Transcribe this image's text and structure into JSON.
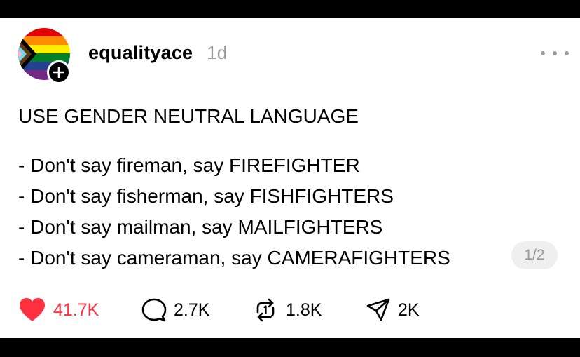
{
  "post": {
    "username": "equalityace",
    "timestamp": "1d",
    "headline": "USE GENDER NEUTRAL LANGUAGE",
    "lines": [
      "- Don't say fireman, say FIREFIGHTER",
      "- Don't say fisherman, say FISHFIGHTERS",
      "- Don't say mailman, say MAILFIGHTERS",
      "- Don't say cameraman, say CAMERAFIGHTERS"
    ],
    "page_indicator": "1/2"
  },
  "actions": {
    "likes": "41.7K",
    "replies": "2.7K",
    "reposts": "1.8K",
    "shares": "2K"
  },
  "colors": {
    "like_red": "#ff3040",
    "muted_gray": "#9a9a9a"
  },
  "icons": [
    "progress-pride-flag-avatar",
    "plus-icon",
    "more-options-icon",
    "heart-icon",
    "comment-icon",
    "repost-icon",
    "share-icon"
  ]
}
